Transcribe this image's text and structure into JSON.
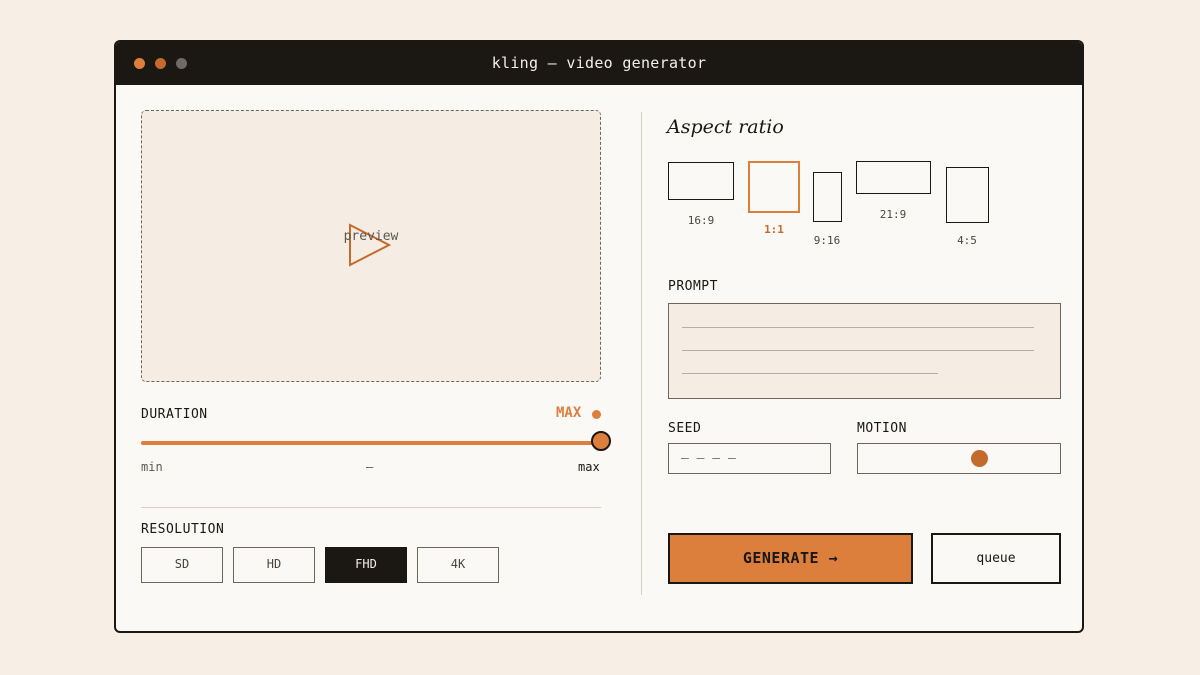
{
  "window": {
    "title": "kling — video generator"
  },
  "colors": {
    "accent": "#dc7f3c",
    "accent_dark": "#c46a2c",
    "ink": "#1b1713",
    "paper": "#fbf9f6",
    "background": "#f7efe6"
  },
  "preview": {
    "label": "preview",
    "icon": "play-icon"
  },
  "duration": {
    "label": "DURATION",
    "value_label": "MAX",
    "value_fraction": 1.0,
    "min_label": "min",
    "mid_label": "—",
    "max_label": "max"
  },
  "resolution": {
    "label": "RESOLUTION",
    "options": [
      "SD",
      "HD",
      "FHD",
      "4K"
    ],
    "selected": "FHD"
  },
  "aspect": {
    "title": "Aspect ratio",
    "options": [
      "16:9",
      "1:1",
      "9:16",
      "21:9",
      "4:5"
    ],
    "selected": "1:1"
  },
  "prompt": {
    "label": "PROMPT"
  },
  "seed": {
    "label": "SEED",
    "placeholder": "— — — —"
  },
  "motion": {
    "label": "MOTION",
    "value_fraction": 0.6
  },
  "actions": {
    "generate_label": "GENERATE →",
    "queue_label": "queue"
  }
}
